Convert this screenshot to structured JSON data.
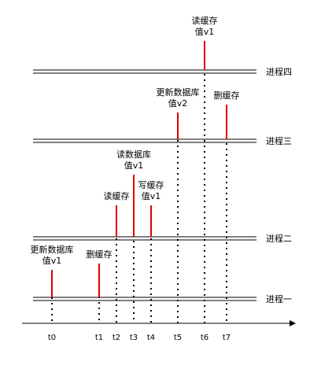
{
  "processes": [
    {
      "id": "p1",
      "label": "进程一"
    },
    {
      "id": "p2",
      "label": "进程二"
    },
    {
      "id": "p3",
      "label": "进程三"
    },
    {
      "id": "p4",
      "label": "进程四"
    }
  ],
  "time_points": [
    "t0",
    "t1",
    "t2",
    "t3",
    "t4",
    "t5",
    "t6",
    "t7"
  ],
  "events": [
    {
      "time": "t0",
      "process": "p1",
      "lines": [
        "更新数据库",
        "值v1"
      ]
    },
    {
      "time": "t1",
      "process": "p1",
      "lines": [
        "删缓存"
      ]
    },
    {
      "time": "t2",
      "process": "p2",
      "lines": [
        "读缓存"
      ]
    },
    {
      "time": "t3",
      "process": "p2",
      "lines": [
        "读数据库",
        "值v1"
      ]
    },
    {
      "time": "t4",
      "process": "p2",
      "lines": [
        "写缓存",
        "值v1"
      ]
    },
    {
      "time": "t5",
      "process": "p3",
      "lines": [
        "更新数据库",
        "值v2"
      ]
    },
    {
      "time": "t6",
      "process": "p4",
      "lines": [
        "读缓存",
        "值v1"
      ]
    },
    {
      "time": "t7",
      "process": "p3",
      "lines": [
        "删缓存"
      ]
    }
  ],
  "colors": {
    "event_bar": "#e00000",
    "lines": "#000000"
  }
}
